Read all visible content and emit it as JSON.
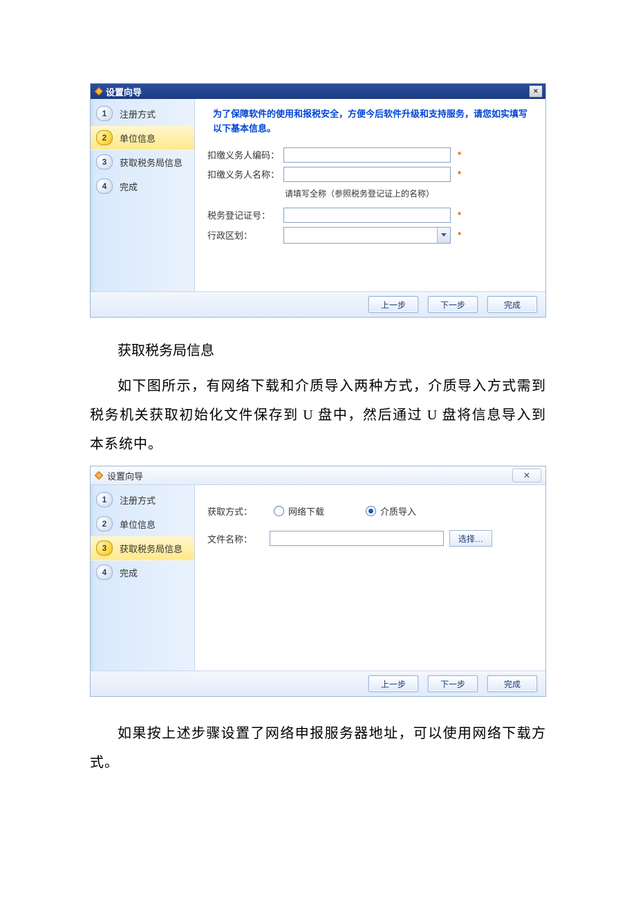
{
  "dialog1": {
    "title": "设置向导",
    "steps": [
      {
        "num": "1",
        "label": "注册方式",
        "active": false
      },
      {
        "num": "2",
        "label": "单位信息",
        "active": true
      },
      {
        "num": "3",
        "label": "获取税务局信息",
        "active": false
      },
      {
        "num": "4",
        "label": "完成",
        "active": false
      }
    ],
    "instruction": "为了保障软件的使用和报税安全，方便今后软件升级和支持服务，请您如实填写以下基本信息。",
    "fields": {
      "code_label": "扣缴义务人编码：",
      "code_value": "",
      "name_label": "扣缴义务人名称：",
      "name_value": "",
      "name_hint": "请填写全称（参照税务登记证上的名称）",
      "taxreg_label": "税务登记证号：",
      "taxreg_value": "",
      "region_label": "行政区划：",
      "region_value": "",
      "required_mark": "*"
    },
    "buttons": {
      "prev": "上一步",
      "next": "下一步",
      "finish": "完成"
    },
    "close": "×"
  },
  "doc": {
    "section_title": "获取税务局信息",
    "para1": "如下图所示，有网络下载和介质导入两种方式，介质导入方式需到税务机关获取初始化文件保存到 U 盘中，然后通过 U 盘将信息导入到本系统中。",
    "para2": "如果按上述步骤设置了网络申报服务器地址，可以使用网络下载方式。"
  },
  "dialog2": {
    "title": "设置向导",
    "close": "✕",
    "steps": [
      {
        "num": "1",
        "label": "注册方式",
        "active": false
      },
      {
        "num": "2",
        "label": "单位信息",
        "active": false
      },
      {
        "num": "3",
        "label": "获取税务局信息",
        "active": true
      },
      {
        "num": "4",
        "label": "完成",
        "active": false
      }
    ],
    "method_label": "获取方式：",
    "option_net": "网络下载",
    "option_media": "介质导入",
    "file_label": "文件名称：",
    "file_value": "",
    "browse": "选择…",
    "buttons": {
      "prev": "上一步",
      "next": "下一步",
      "finish": "完成"
    }
  }
}
